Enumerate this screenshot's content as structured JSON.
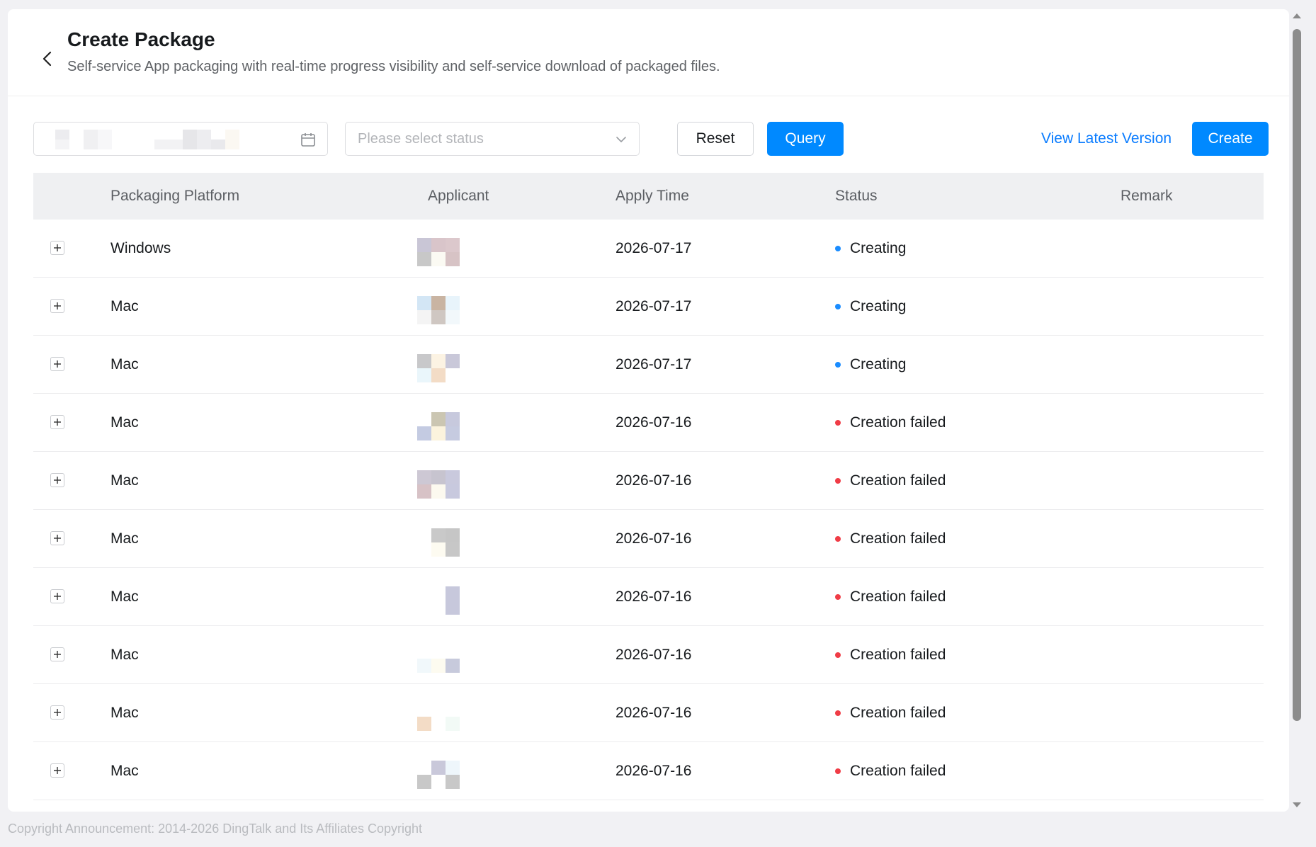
{
  "header": {
    "title": "Create Package",
    "subtitle": "Self-service App packaging with real-time progress visibility and self-service download of packaged files."
  },
  "toolbar": {
    "status_placeholder": "Please select status",
    "reset_label": "Reset",
    "query_label": "Query",
    "view_latest_label": "View Latest Version",
    "create_label": "Create"
  },
  "table": {
    "columns": [
      "Packaging Platform",
      "Applicant",
      "Apply Time",
      "Status",
      "Remark"
    ],
    "rows": [
      {
        "platform": "Windows",
        "apply_time": "2026-07-17",
        "status": "Creating",
        "remark": ""
      },
      {
        "platform": "Mac",
        "apply_time": "2026-07-17",
        "status": "Creating",
        "remark": ""
      },
      {
        "platform": "Mac",
        "apply_time": "2026-07-17",
        "status": "Creating",
        "remark": ""
      },
      {
        "platform": "Mac",
        "apply_time": "2026-07-16",
        "status": "Creation failed",
        "remark": ""
      },
      {
        "platform": "Mac",
        "apply_time": "2026-07-16",
        "status": "Creation failed",
        "remark": ""
      },
      {
        "platform": "Mac",
        "apply_time": "2026-07-16",
        "status": "Creation failed",
        "remark": ""
      },
      {
        "platform": "Mac",
        "apply_time": "2026-07-16",
        "status": "Creation failed",
        "remark": ""
      },
      {
        "platform": "Mac",
        "apply_time": "2026-07-16",
        "status": "Creation failed",
        "remark": ""
      },
      {
        "platform": "Mac",
        "apply_time": "2026-07-16",
        "status": "Creation failed",
        "remark": ""
      },
      {
        "platform": "Mac",
        "apply_time": "2026-07-16",
        "status": "Creation failed",
        "remark": ""
      }
    ]
  },
  "status_colors": {
    "Creating": "#1a8cff",
    "Creation failed": "#f03c46"
  },
  "colors": {
    "primary": "#0089ff",
    "link": "#0a7cff"
  },
  "icons": [
    "back-arrow-icon",
    "calendar-icon",
    "chevron-down-icon",
    "plus-icon"
  ],
  "footer": {
    "copyright": "Copyright Announcement: 2014-2026 DingTalk and Its Affiliates Copyright"
  }
}
